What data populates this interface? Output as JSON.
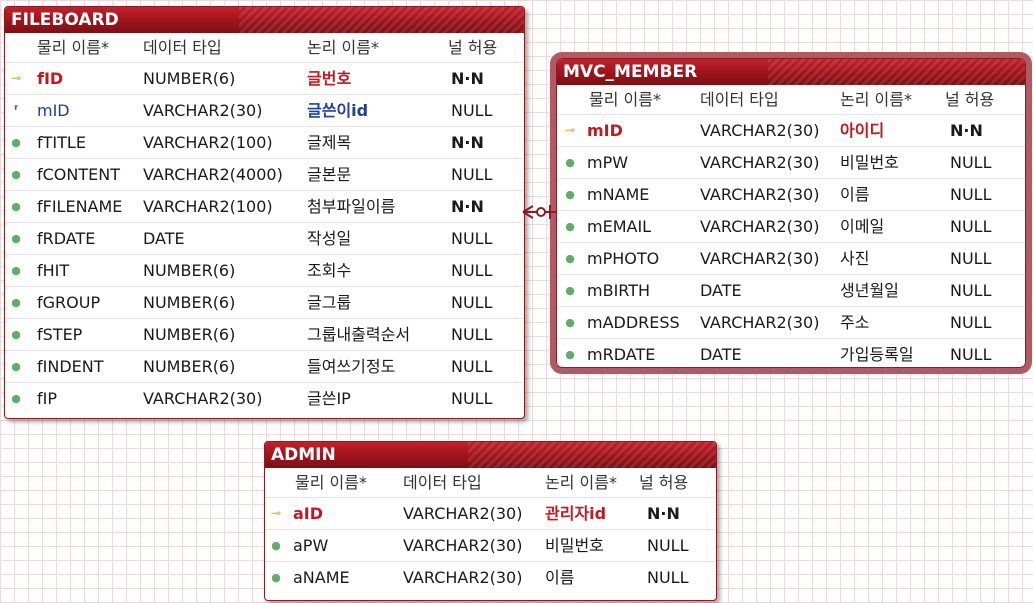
{
  "headers": {
    "physical": "물리 이름*",
    "datatype": "데이터 타입",
    "logical": "논리 이름*",
    "nullable": "널 허용"
  },
  "entities": {
    "fileboard": {
      "title": "FILEBOARD",
      "rows": [
        {
          "name": "fID",
          "type": "NUMBER(6)",
          "logical": "글번호",
          "null": "N·N",
          "icon": "pk"
        },
        {
          "name": "mID",
          "type": "VARCHAR2(30)",
          "logical": "글쓴이id",
          "null": "NULL",
          "icon": "fk"
        },
        {
          "name": "fTITLE",
          "type": "VARCHAR2(100)",
          "logical": "글제목",
          "null": "N·N",
          "icon": "dot"
        },
        {
          "name": "fCONTENT",
          "type": "VARCHAR2(4000)",
          "logical": "글본문",
          "null": "NULL",
          "icon": "dot"
        },
        {
          "name": "fFILENAME",
          "type": "VARCHAR2(100)",
          "logical": "첨부파일이름",
          "null": "N·N",
          "icon": "dot"
        },
        {
          "name": "fRDATE",
          "type": "DATE",
          "logical": "작성일",
          "null": "NULL",
          "icon": "dot"
        },
        {
          "name": "fHIT",
          "type": "NUMBER(6)",
          "logical": "조회수",
          "null": "NULL",
          "icon": "dot"
        },
        {
          "name": "fGROUP",
          "type": "NUMBER(6)",
          "logical": "글그룹",
          "null": "NULL",
          "icon": "dot"
        },
        {
          "name": "fSTEP",
          "type": "NUMBER(6)",
          "logical": "그룹내출력순서",
          "null": "NULL",
          "icon": "dot"
        },
        {
          "name": "fINDENT",
          "type": "NUMBER(6)",
          "logical": "들여쓰기정도",
          "null": "NULL",
          "icon": "dot"
        },
        {
          "name": "fIP",
          "type": "VARCHAR2(30)",
          "logical": "글쓴IP",
          "null": "NULL",
          "icon": "dot"
        }
      ]
    },
    "mvc_member": {
      "title": "MVC_MEMBER",
      "rows": [
        {
          "name": "mID",
          "type": "VARCHAR2(30)",
          "logical": "아이디",
          "null": "N·N",
          "icon": "pk"
        },
        {
          "name": "mPW",
          "type": "VARCHAR2(30)",
          "logical": "비밀번호",
          "null": "NULL",
          "icon": "dot"
        },
        {
          "name": "mNAME",
          "type": "VARCHAR2(30)",
          "logical": "이름",
          "null": "NULL",
          "icon": "dot"
        },
        {
          "name": "mEMAIL",
          "type": "VARCHAR2(30)",
          "logical": "이메일",
          "null": "NULL",
          "icon": "dot"
        },
        {
          "name": "mPHOTO",
          "type": "VARCHAR2(30)",
          "logical": "사진",
          "null": "NULL",
          "icon": "dot"
        },
        {
          "name": "mBIRTH",
          "type": "DATE",
          "logical": "생년월일",
          "null": "NULL",
          "icon": "dot"
        },
        {
          "name": "mADDRESS",
          "type": "VARCHAR2(30)",
          "logical": "주소",
          "null": "NULL",
          "icon": "dot"
        },
        {
          "name": "mRDATE",
          "type": "DATE",
          "logical": "가입등록일",
          "null": "NULL",
          "icon": "dot"
        }
      ]
    },
    "admin": {
      "title": "ADMIN",
      "rows": [
        {
          "name": "aID",
          "type": "VARCHAR2(30)",
          "logical": "관리자id",
          "null": "N·N",
          "icon": "pk"
        },
        {
          "name": "aPW",
          "type": "VARCHAR2(30)",
          "logical": "비밀번호",
          "null": "NULL",
          "icon": "dot"
        },
        {
          "name": "aNAME",
          "type": "VARCHAR2(30)",
          "logical": "이름",
          "null": "NULL",
          "icon": "dot"
        }
      ]
    }
  },
  "icons": {
    "pk": "key-icon",
    "fk": "foreign-key-icon",
    "dot": "column-dot-icon"
  },
  "colors": {
    "title_bar": "#9c141b",
    "primary_key_text": "#c41820",
    "foreign_key_text": "#1e3f9a",
    "column_dot": "#5fae6a",
    "relationship_line": "#8a1c24"
  }
}
